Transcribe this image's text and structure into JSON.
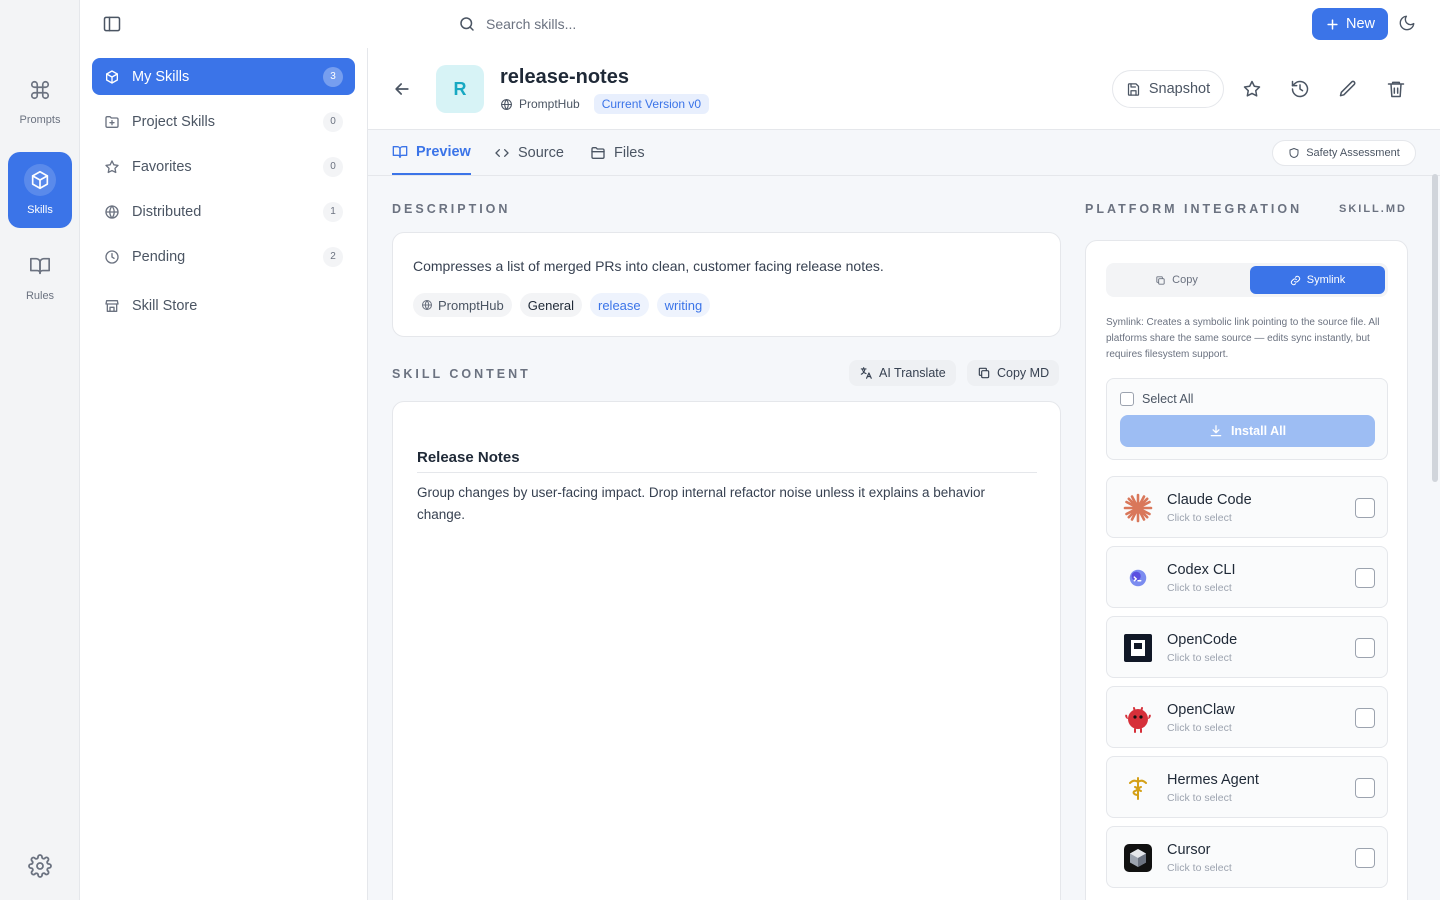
{
  "rail": {
    "items": [
      {
        "label": "Prompts",
        "icon": "command-icon"
      },
      {
        "label": "Skills",
        "icon": "cube-icon",
        "active": true
      },
      {
        "label": "Rules",
        "icon": "book-icon"
      }
    ]
  },
  "topbar": {
    "search_placeholder": "Search skills...",
    "new_label": "New"
  },
  "sidebar": {
    "items": [
      {
        "label": "My Skills",
        "count": "3",
        "icon": "cube-icon"
      },
      {
        "label": "Project Skills",
        "count": "0",
        "icon": "folder-plus-icon"
      },
      {
        "label": "Favorites",
        "count": "0",
        "icon": "star-icon"
      },
      {
        "label": "Distributed",
        "count": "1",
        "icon": "globe-icon"
      },
      {
        "label": "Pending",
        "count": "2",
        "icon": "clock-icon"
      },
      {
        "label": "Skill Store",
        "icon": "store-icon"
      }
    ]
  },
  "skill": {
    "avatar_letter": "R",
    "name": "release-notes",
    "source": "PromptHub",
    "version": "Current Version v0",
    "snapshot_label": "Snapshot"
  },
  "tabs": [
    {
      "label": "Preview"
    },
    {
      "label": "Source"
    },
    {
      "label": "Files"
    }
  ],
  "safety_label": "Safety Assessment",
  "description": {
    "section_title": "DESCRIPTION",
    "text": "Compresses a list of merged PRs into clean, customer facing release notes.",
    "tags": [
      "PromptHub",
      "General",
      "release",
      "writing"
    ]
  },
  "skill_content": {
    "section_title": "SKILL CONTENT",
    "translate_label": "AI Translate",
    "copy_label": "Copy MD",
    "heading": "Release Notes",
    "body": "Group changes by user-facing impact. Drop internal refactor noise unless it explains a behavior change."
  },
  "platform": {
    "section_title": "PLATFORM INTEGRATION",
    "file_label": "SKILL.MD",
    "copy_label": "Copy",
    "symlink_label": "Symlink",
    "note": "Symlink: Creates a symbolic link pointing to the source file. All platforms share the same source — edits sync instantly, but requires filesystem support.",
    "select_all_label": "Select All",
    "install_all_label": "Install All",
    "items": [
      {
        "name": "Claude Code",
        "sub": "Click to select"
      },
      {
        "name": "Codex CLI",
        "sub": "Click to select"
      },
      {
        "name": "OpenCode",
        "sub": "Click to select"
      },
      {
        "name": "OpenClaw",
        "sub": "Click to select"
      },
      {
        "name": "Hermes Agent",
        "sub": "Click to select"
      },
      {
        "name": "Cursor",
        "sub": "Click to select"
      }
    ]
  },
  "colors": {
    "accent": "#3b74e8",
    "avatar_bg": "#d7f3f6",
    "claude": "#d9775a",
    "openclaw": "#d6303a"
  }
}
